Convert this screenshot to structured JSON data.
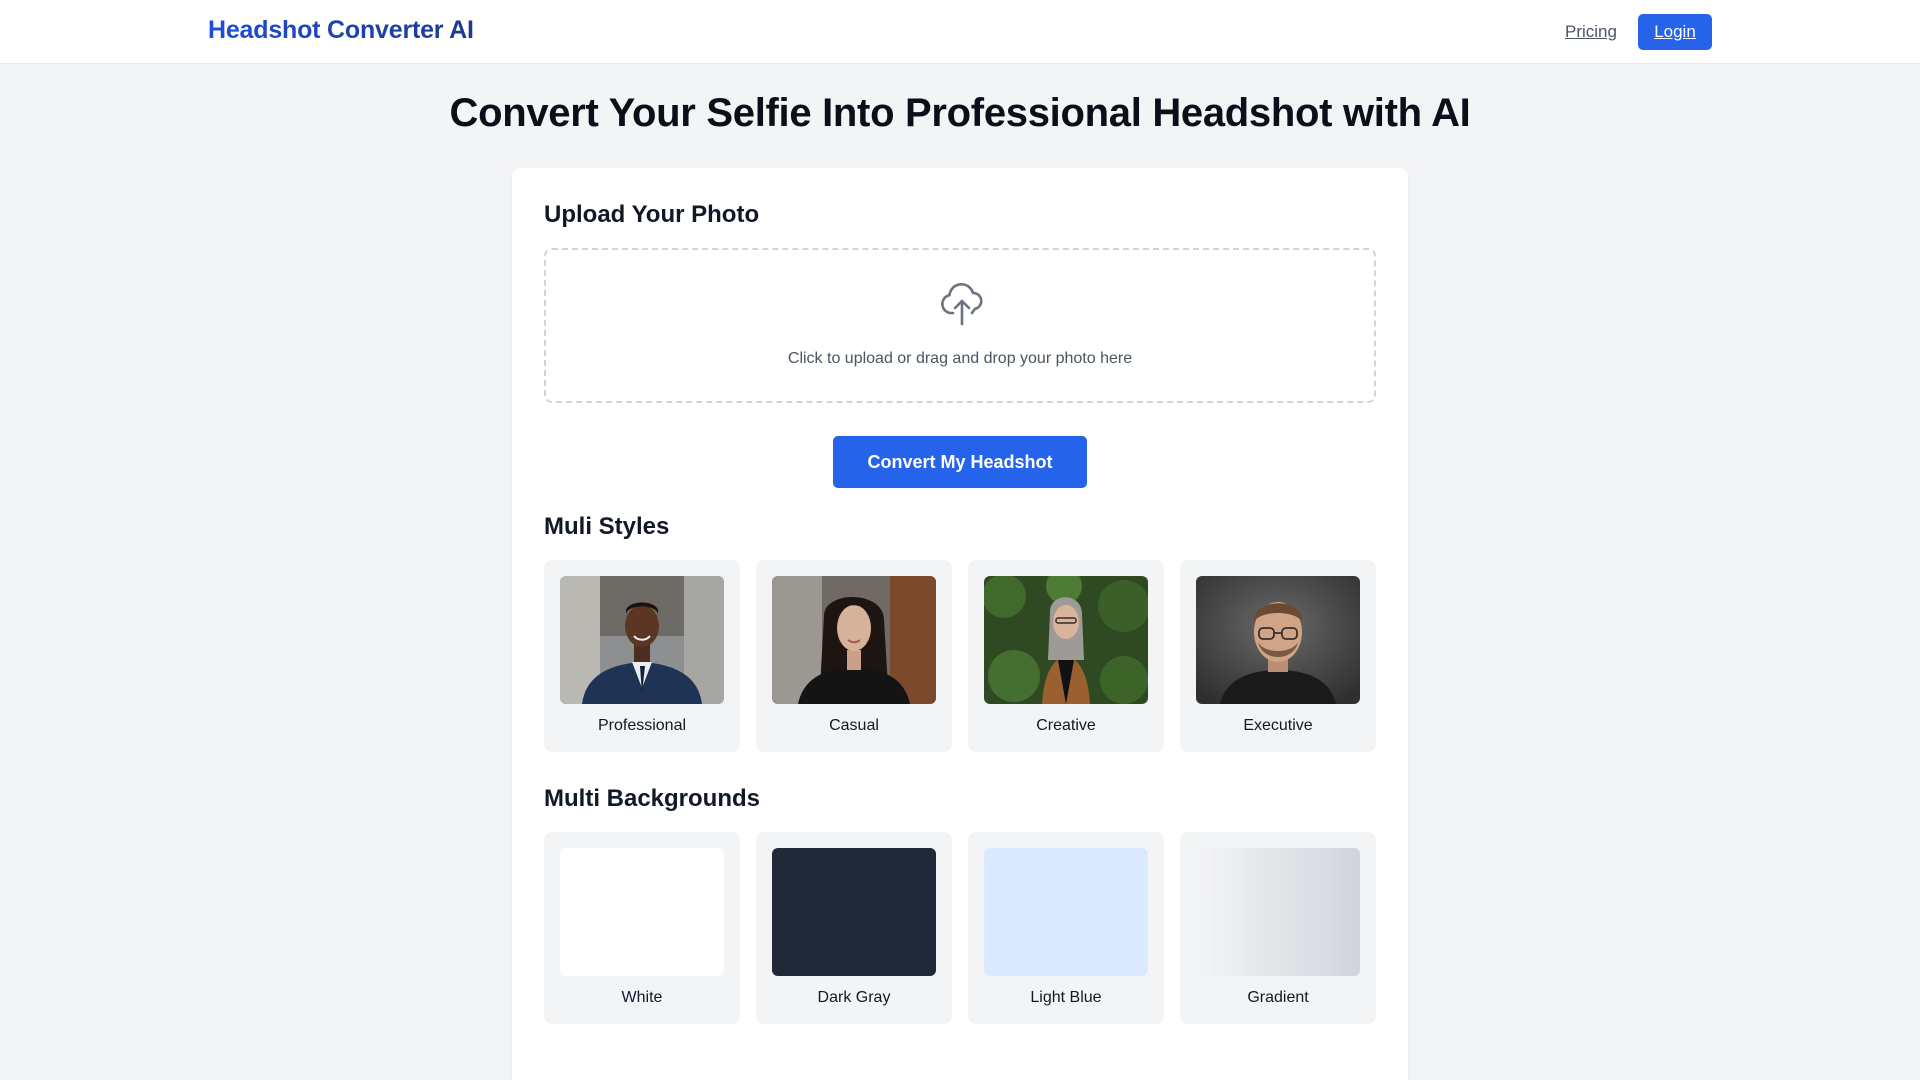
{
  "header": {
    "brand": "Headshot Converter AI",
    "pricing_label": "Pricing",
    "login_label": "Login"
  },
  "hero": {
    "title": "Convert Your Selfie Into Professional Headshot with AI"
  },
  "upload": {
    "section_title": "Upload Your Photo",
    "icon": "cloud-upload-icon",
    "hint": "Click to upload or drag and drop your photo here",
    "convert_label": "Convert My Headshot"
  },
  "styles": {
    "section_title": "Muli Styles",
    "items": [
      {
        "label": "Professional"
      },
      {
        "label": "Casual"
      },
      {
        "label": "Creative"
      },
      {
        "label": "Executive"
      }
    ]
  },
  "backgrounds": {
    "section_title": "Multi Backgrounds",
    "items": [
      {
        "label": "White",
        "color": "#ffffff"
      },
      {
        "label": "Dark Gray",
        "color": "#1f2937"
      },
      {
        "label": "Light Blue",
        "color": "#dbeafe"
      },
      {
        "label": "Gradient",
        "color": "linear-gradient(90deg, #f3f4f6, #d1d5db)"
      }
    ]
  },
  "colors": {
    "primary": "#2563eb",
    "page_bg": "#f3f4f6",
    "tile_bg": "#f3f4f6"
  }
}
